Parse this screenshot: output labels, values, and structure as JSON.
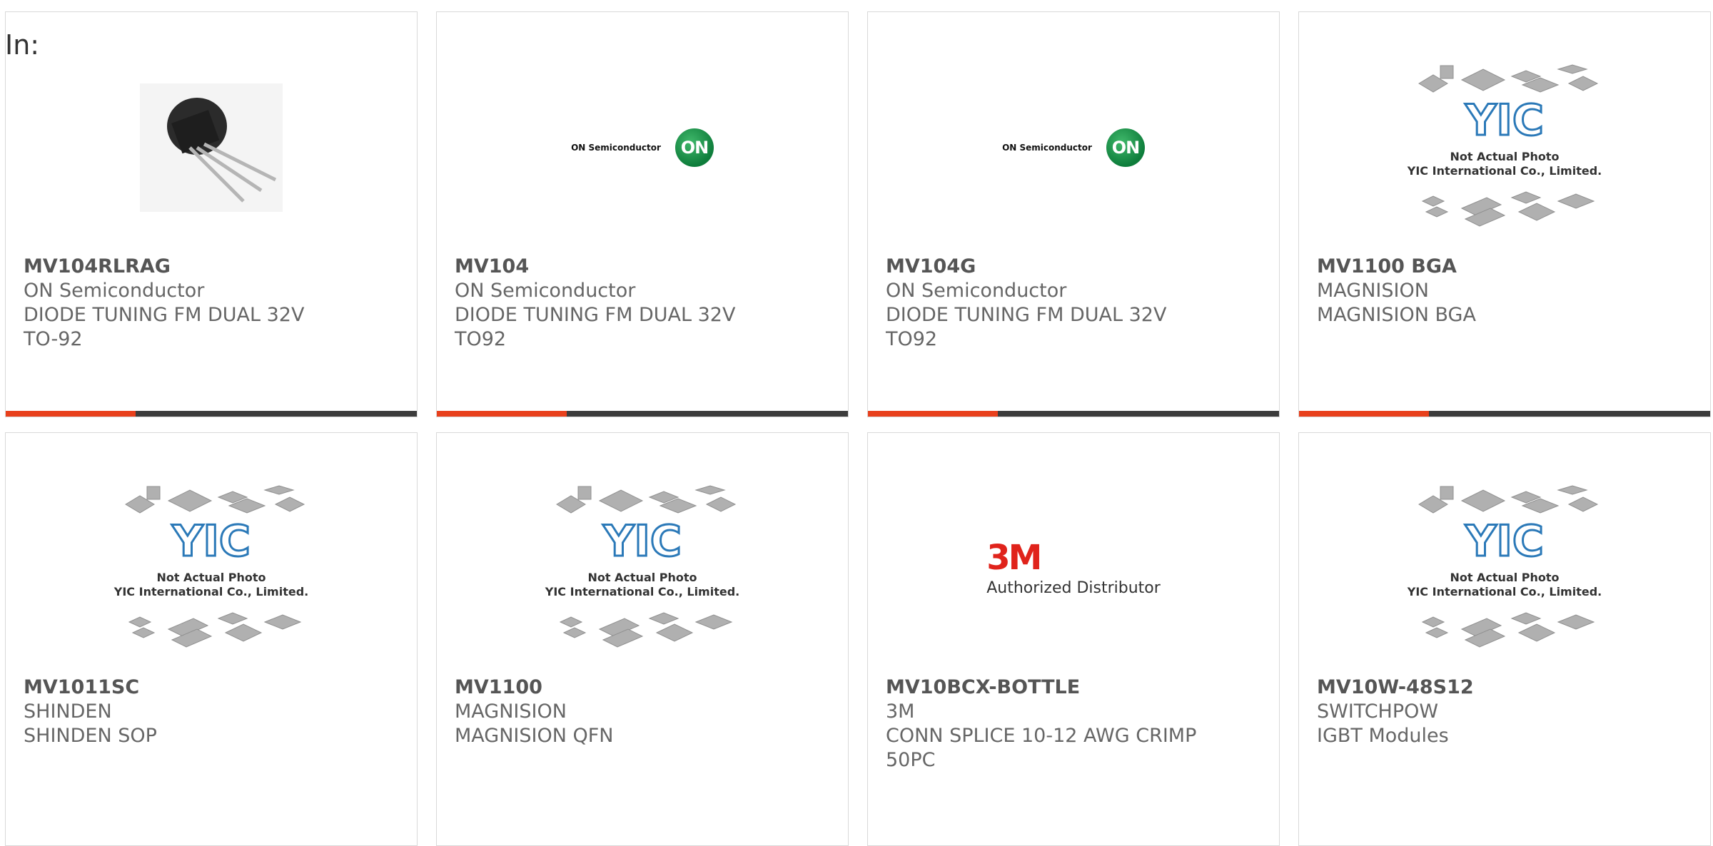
{
  "header": {
    "label": "In:"
  },
  "products": [
    {
      "part": "MV104RLRAG",
      "maker": "ON Semiconductor",
      "desc": "DIODE TUNING FM DUAL 32V",
      "pkg": "TO-92",
      "image": "transistor"
    },
    {
      "part": "MV104",
      "maker": "ON Semiconductor",
      "desc": "DIODE TUNING FM DUAL 32V",
      "pkg": "TO92",
      "image": "on-logo"
    },
    {
      "part": "MV104G",
      "maker": "ON Semiconductor",
      "desc": "DIODE TUNING FM DUAL 32V",
      "pkg": "TO92",
      "image": "on-logo"
    },
    {
      "part": "MV1100 BGA",
      "maker": "MAGNISION",
      "desc": "MAGNISION BGA",
      "pkg": "",
      "image": "yic"
    },
    {
      "part": "MV1011SC",
      "maker": "SHINDEN",
      "desc": "SHINDEN SOP",
      "pkg": "",
      "image": "yic"
    },
    {
      "part": "MV1100",
      "maker": "MAGNISION",
      "desc": "MAGNISION QFN",
      "pkg": "",
      "image": "yic"
    },
    {
      "part": "MV10BCX-BOTTLE",
      "maker": "3M",
      "desc": "CONN SPLICE 10-12 AWG CRIMP",
      "pkg": "50PC",
      "image": "3m-logo"
    },
    {
      "part": "MV10W-48S12",
      "maker": "SWITCHPOW",
      "desc": "IGBT Modules",
      "pkg": "",
      "image": "yic"
    }
  ],
  "logos": {
    "on_text": "ON Semiconductor",
    "on_mark": "ON",
    "tm_text": "3M",
    "tm_sub": "Authorized Distributor",
    "yic_mark": "YIC",
    "yic_line1": "Not Actual Photo",
    "yic_line2": "YIC International Co., Limited."
  },
  "colors": {
    "accent": "#e8401c",
    "bar": "#3c3c3c",
    "text": "#666666"
  }
}
